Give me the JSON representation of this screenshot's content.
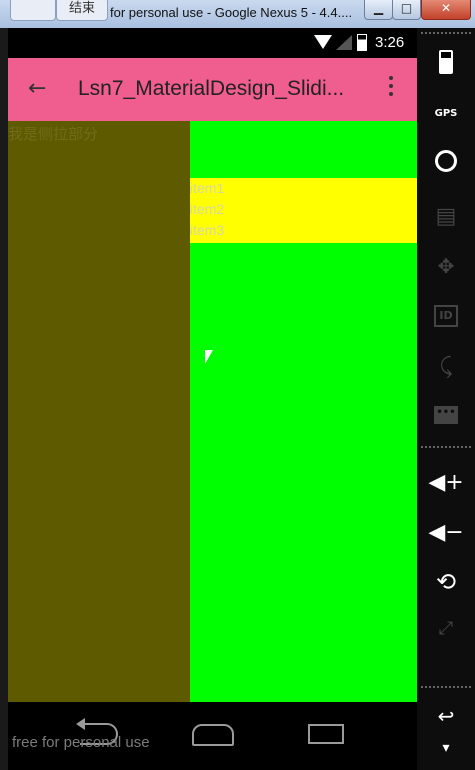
{
  "window": {
    "home_icon": "home-icon",
    "end_tab_label": "结束",
    "title": "for personal use - Google Nexus 5 - 4.4....",
    "minimize_label": "▁",
    "maximize_label": "□",
    "close_label": "✕"
  },
  "status_bar": {
    "time": "3:26",
    "icons": [
      "wifi-icon",
      "signal-icon",
      "battery-icon"
    ]
  },
  "app_bar": {
    "title": "Lsn7_MaterialDesign_Slidi...",
    "back_icon": "arrow-back-icon",
    "overflow_icon": "more-vert-icon",
    "color": "#f05e8f"
  },
  "drawer": {
    "text": "我是侧拉部分",
    "color": "#5e5a00"
  },
  "main": {
    "color": "#00ff00",
    "list_color": "#ffff00",
    "items": [
      {
        "label": "item1"
      },
      {
        "label": "item2"
      },
      {
        "label": "item3"
      }
    ]
  },
  "nav_bar": {
    "back": "nav-back-icon",
    "home": "nav-home-icon",
    "recents": "nav-recents-icon",
    "watermark": "free for personal use"
  },
  "toolbar": {
    "gps_label": "GPS",
    "id_label": "ID",
    "msg_label": "•••",
    "volume_up": "◀+",
    "volume_down": "◀−",
    "rotate": "⟲",
    "fullscreen": "⤢",
    "back": "↩",
    "down": "▾"
  }
}
